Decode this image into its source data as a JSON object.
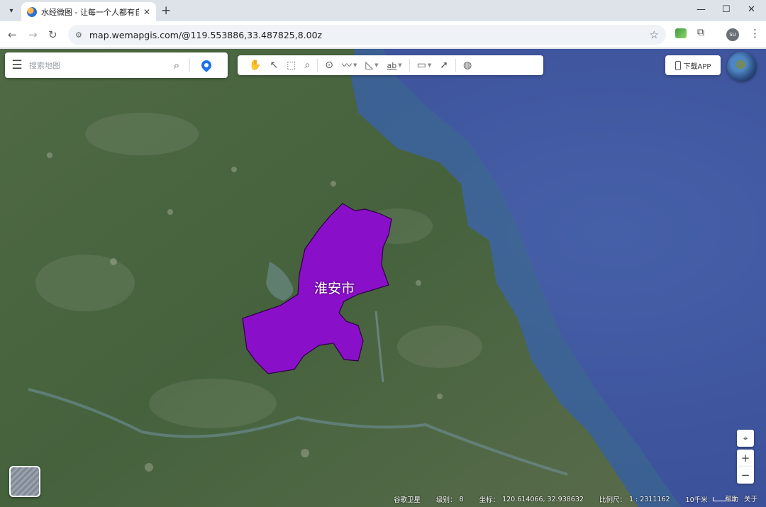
{
  "browser": {
    "tab_title": "水经微图 - 让每一个人都有自己",
    "tab_close": "✕",
    "new_tab": "+",
    "url": "map.wemapgis.com/@119.553886,33.487825,8.00z",
    "profile_initials": "SU"
  },
  "map": {
    "search_placeholder": "搜索地图",
    "download_app_label": "下载APP",
    "region_label": "淮安市",
    "region_color": "#8a0fc8",
    "toolbar_tools": [
      "pan-hand-icon",
      "select-arrow-icon",
      "box-select-icon",
      "zoom-query-icon",
      "marker-icon",
      "polyline-icon",
      "polygon-icon",
      "text-label-icon",
      "measure-ruler-icon",
      "identify-icon",
      "globe-icon"
    ],
    "text_tool_label": "ab",
    "zoom_in": "+",
    "zoom_out": "−"
  },
  "status": {
    "layer_name": "谷歌卫星",
    "level_label": "级别：",
    "level_value": "8",
    "coord_label": "坐标：",
    "coord_value": "120.614066, 32.938632",
    "scale_label": "比例尺：",
    "scale_value": "1 : 2311162",
    "scale_bar_label": "10千米"
  },
  "footer": {
    "help": "帮助",
    "about": "关于"
  }
}
